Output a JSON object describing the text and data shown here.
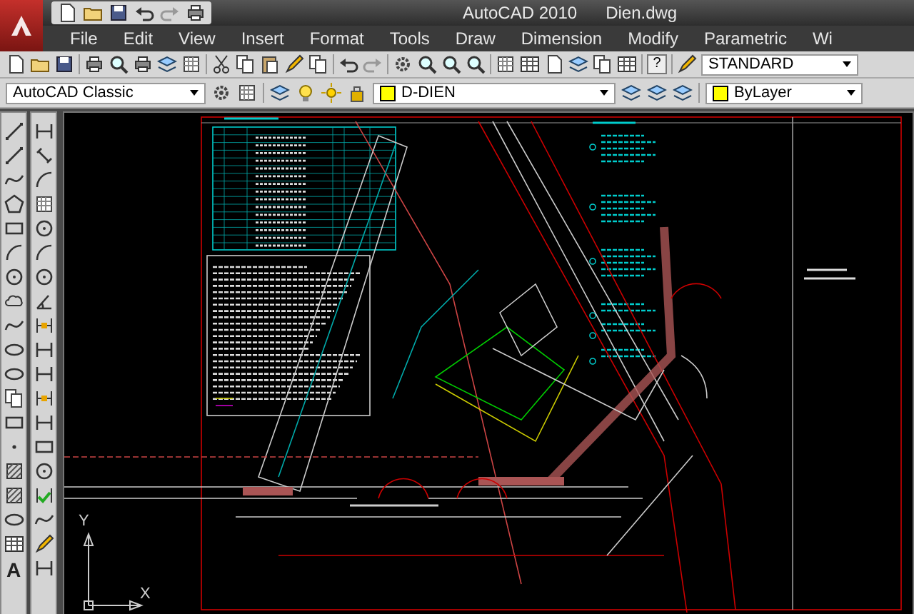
{
  "window": {
    "title": "AutoCAD 2010",
    "document": "Dien.dwg"
  },
  "menu": [
    "File",
    "Edit",
    "View",
    "Insert",
    "Format",
    "Tools",
    "Draw",
    "Dimension",
    "Modify",
    "Parametric",
    "Wi"
  ],
  "standard_toolbar": {
    "help_glyph": "?",
    "text_style": "STANDARD"
  },
  "workspace_toolbar": {
    "workspace": "AutoCAD Classic"
  },
  "layers_toolbar": {
    "layer": "D-DIEN"
  },
  "properties_toolbar": {
    "color_setting": "ByLayer"
  },
  "draw_toolbar": {
    "text_glyph": "A"
  },
  "ucs": {
    "y_label": "Y",
    "x_label": "X"
  }
}
